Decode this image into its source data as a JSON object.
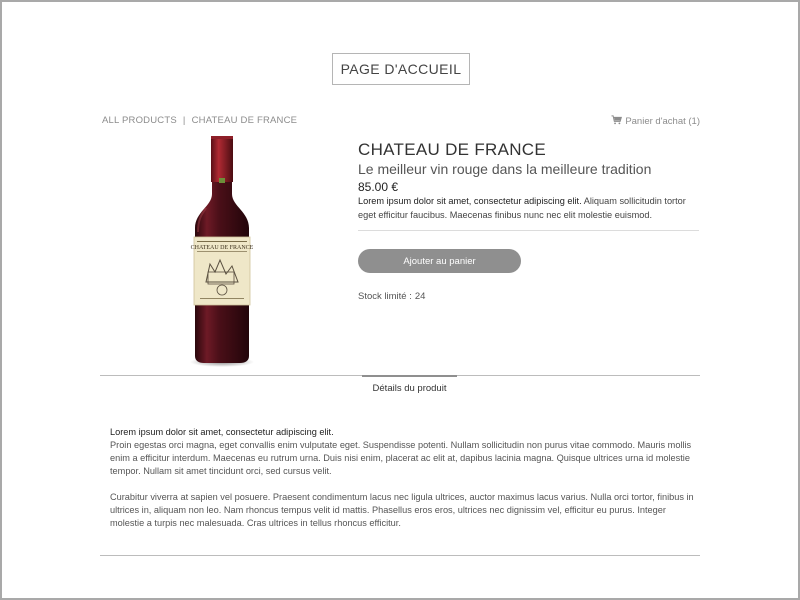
{
  "header": {
    "home_button": "PAGE D'ACCUEIL"
  },
  "breadcrumb": {
    "root": "ALL PRODUCTS",
    "separator": "|",
    "current": "CHATEAU DE FRANCE"
  },
  "cart": {
    "icon": "cart-icon",
    "label": "Panier d'achat (1)"
  },
  "product": {
    "image_label": "CHATEAU DE FRANCE",
    "title": "CHATEAU DE FRANCE",
    "subtitle": "Le meilleur vin rouge dans la meilleure tradition",
    "price": "85.00 €",
    "description_lead": "Lorem ipsum dolor sit amet, consectetur adipiscing elit.",
    "description_rest": " Aliquam sollicitudin tortor eget efficitur faucibus. Maecenas finibus nunc nec elit molestie euismod.",
    "add_to_cart": "Ajouter au panier",
    "stock_label": "Stock limité",
    "stock_sep": ":",
    "stock_value": "24"
  },
  "tabs": [
    {
      "label": "Détails du produit",
      "active": true
    }
  ],
  "details": {
    "lead": "Lorem ipsum dolor sit amet, consectetur adipiscing elit.",
    "paragraph1": "Proin egestas orci magna, eget convallis enim vulputate eget. Suspendisse potenti. Nullam sollicitudin non purus vitae commodo. Mauris mollis enim a efficitur interdum. Maecenas eu rutrum urna. Duis nisi enim, placerat ac elit at, dapibus lacinia magna. Quisque ultrices urna id molestie tempor. Nullam sit amet tincidunt orci, sed cursus velit.",
    "paragraph2": "Curabitur viverra at sapien vel posuere. Praesent condimentum lacus nec ligula ultrices, auctor maximus lacus varius. Nulla orci tortor, finibus in ultrices in, aliquam non leo. Nam rhoncus tempus velit id mattis. Phasellus eros eros, ultrices nec dignissim vel, efficitur eu purus. Integer molestie a turpis nec malesuada. Cras ultrices in tellus rhoncus efficitur."
  },
  "colors": {
    "button_gray": "#8f8f8f",
    "wine": "#5a1620",
    "label_cream": "#efe7c8"
  }
}
